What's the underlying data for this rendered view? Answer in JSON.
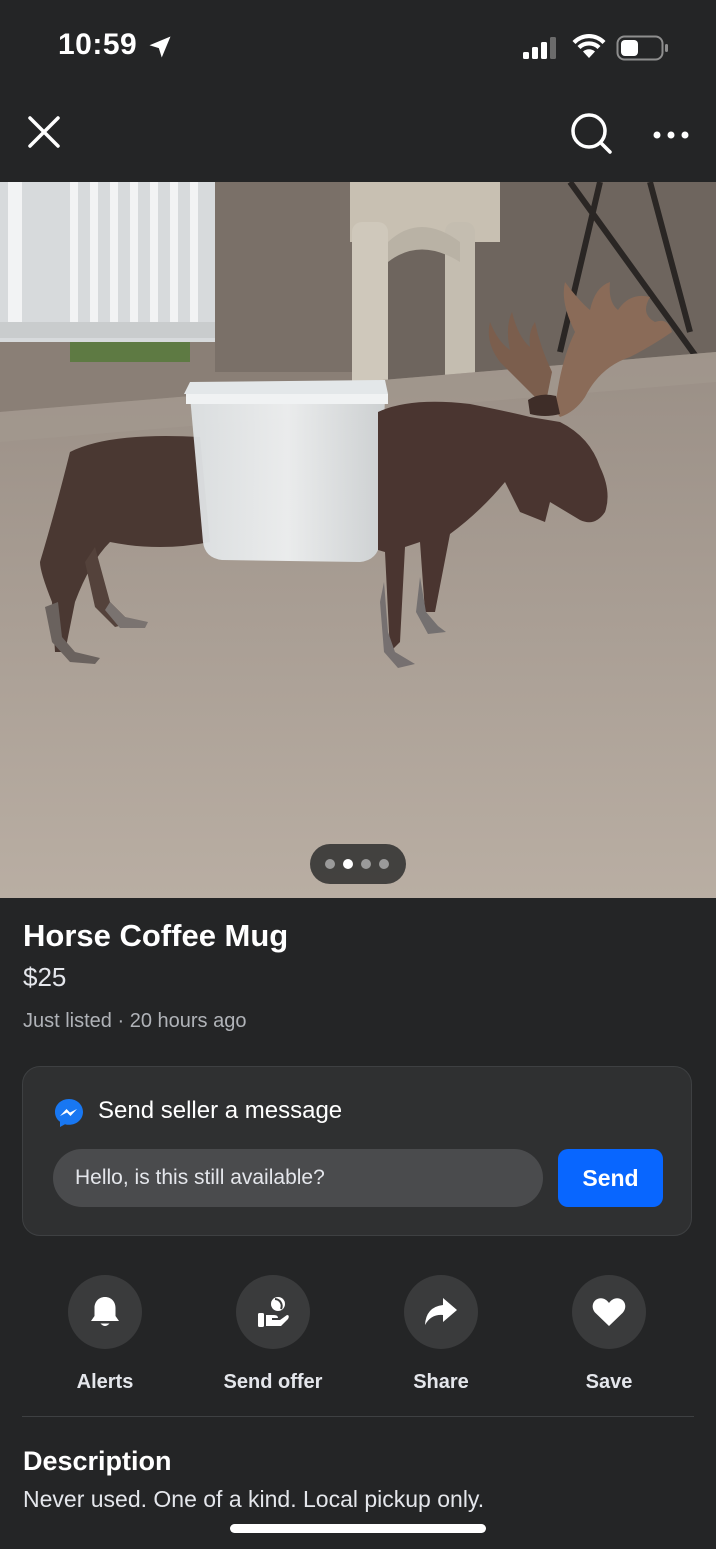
{
  "status_bar": {
    "time": "10:59"
  },
  "listing": {
    "title": "Horse Coffee Mug",
    "price": "$25",
    "meta": "Just listed · 20 hours ago",
    "photo_count": 4,
    "photo_index": 2
  },
  "message": {
    "heading": "Send seller a message",
    "input_value": "Hello, is this still available?",
    "send_label": "Send"
  },
  "actions": [
    {
      "label": "Alerts",
      "icon": "bell-icon"
    },
    {
      "label": "Send offer",
      "icon": "offer-icon"
    },
    {
      "label": "Share",
      "icon": "share-icon"
    },
    {
      "label": "Save",
      "icon": "heart-icon"
    }
  ],
  "description": {
    "heading": "Description",
    "text": "Never used. One of a kind. Local pickup only."
  },
  "colors": {
    "background": "#242526",
    "accent": "#0866ff",
    "card": "#2f3031",
    "icon_circle": "#3a3b3c"
  }
}
